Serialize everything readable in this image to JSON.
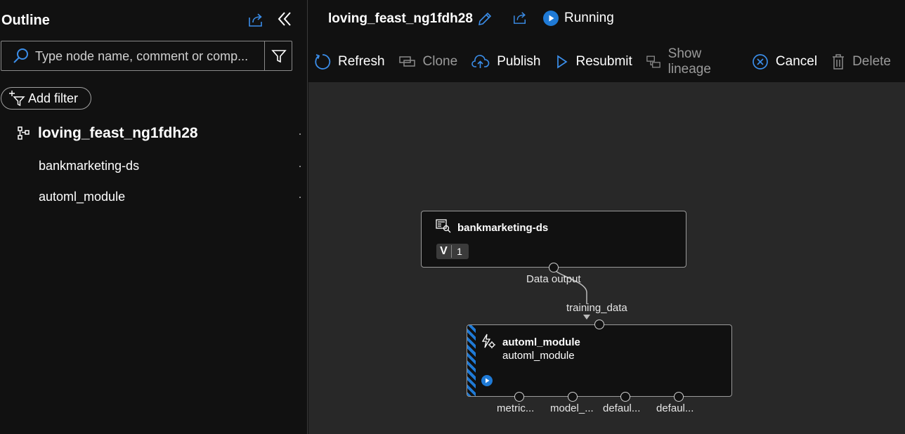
{
  "outline": {
    "title": "Outline",
    "search_placeholder": "Type node name, comment or comp...",
    "add_filter_label": "Add filter",
    "tree": {
      "root": "loving_feast_ng1fdh28",
      "children": [
        "bankmarketing-ds",
        "automl_module"
      ]
    }
  },
  "header": {
    "pipeline_name": "loving_feast_ng1fdh28",
    "status": "Running",
    "toolbar": [
      {
        "label": "Refresh",
        "icon": "refresh-icon",
        "enabled": true
      },
      {
        "label": "Clone",
        "icon": "clone-icon",
        "enabled": false
      },
      {
        "label": "Publish",
        "icon": "cloud-upload-icon",
        "enabled": true
      },
      {
        "label": "Resubmit",
        "icon": "play-outline-icon",
        "enabled": true
      },
      {
        "label": "Show lineage",
        "icon": "lineage-icon",
        "enabled": false
      },
      {
        "label": "Cancel",
        "icon": "cancel-circle-icon",
        "enabled": true
      },
      {
        "label": "Delete",
        "icon": "trash-icon",
        "enabled": false
      }
    ]
  },
  "canvas": {
    "dataset_node": {
      "title": "bankmarketing-ds",
      "version_prefix": "V",
      "version": "1",
      "output_port_label": "Data output"
    },
    "module_node": {
      "title": "automl_module",
      "subtitle": "automl_module",
      "input_port_label": "training_data",
      "output_ports": [
        "metric...",
        "model_...",
        "defaul...",
        "defaul..."
      ]
    }
  },
  "colors": {
    "accent": "#3b8eea",
    "running": "#1f7ad6",
    "canvas_bg": "#282828",
    "panel_bg": "#111111"
  }
}
